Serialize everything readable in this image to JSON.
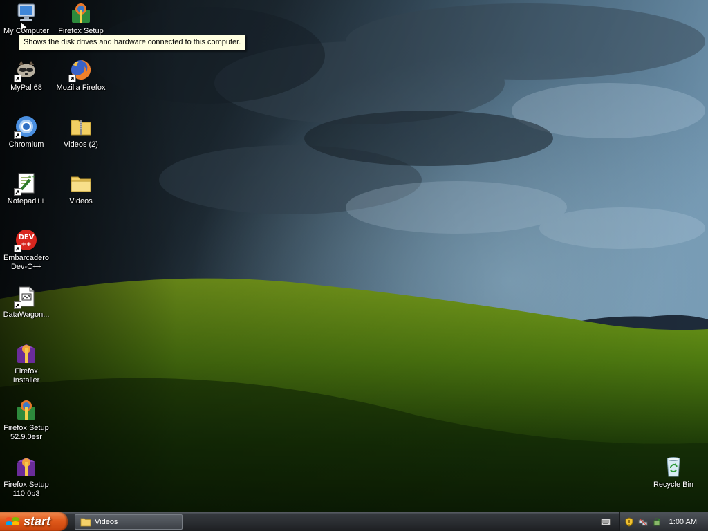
{
  "desktop": {
    "icons": [
      {
        "label": "My Computer",
        "icon": "my-computer-icon"
      },
      {
        "label": "Firefox Setup",
        "icon": "firefox-setup-icon"
      },
      {
        "label": "MyPal 68",
        "icon": "mypal-icon"
      },
      {
        "label": "Mozilla Firefox",
        "icon": "firefox-icon"
      },
      {
        "label": "Chromium",
        "icon": "chromium-icon"
      },
      {
        "label": "Videos (2)",
        "icon": "zip-folder-icon"
      },
      {
        "label": "Notepad++",
        "icon": "notepadpp-icon"
      },
      {
        "label": "Videos",
        "icon": "folder-icon"
      },
      {
        "label": "Embarcadero\nDev-C++",
        "icon": "devcpp-icon"
      },
      {
        "label": "DataWagon...",
        "icon": "document-icon"
      },
      {
        "label": "Firefox\nInstaller",
        "icon": "firefox-installer-icon"
      },
      {
        "label": "Firefox Setup\n52.9.0esr",
        "icon": "firefox-setup-icon"
      },
      {
        "label": "Firefox Setup\n110.0b3",
        "icon": "firefox-installer-icon"
      },
      {
        "label": "Recycle Bin",
        "icon": "recycle-bin-icon"
      }
    ],
    "tooltip": "Shows the disk drives and hardware connected to this computer."
  },
  "taskbar": {
    "start_label": "start",
    "tasks": [
      {
        "label": "Videos",
        "icon": "folder-icon"
      }
    ],
    "tray": {
      "icons": [
        "security-shield-icon",
        "network-icon",
        "safely-remove-icon"
      ],
      "clock": "1:00 AM"
    }
  },
  "colors": {
    "tooltip_bg": "#ffffe1",
    "start_button": "#e05a1b",
    "taskbar": "#2a2d31"
  }
}
